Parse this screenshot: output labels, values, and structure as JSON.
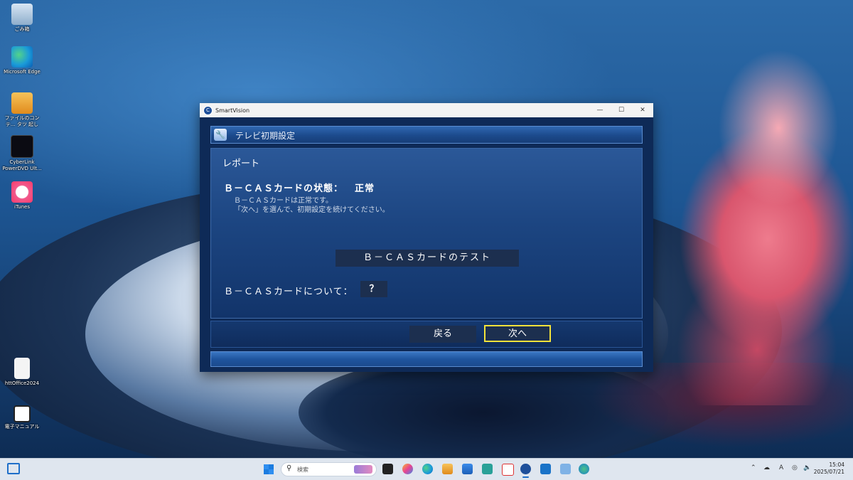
{
  "desktop": {
    "icons": [
      {
        "label": "ごみ箱",
        "icon": "recycle-bin-icon"
      },
      {
        "label": "Microsoft Edge",
        "icon": "edge-icon"
      },
      {
        "label": "ファイルのコンテ... タツ 起し",
        "icon": "folder-shortcut-icon"
      },
      {
        "label": "CyberLink PowerDVD Ult...",
        "icon": "powerdvd-icon"
      },
      {
        "label": "iTunes",
        "icon": "itunes-icon"
      },
      {
        "label": "httOffice2024",
        "icon": "file-icon"
      },
      {
        "label": "電子マニュアル",
        "icon": "manual-icon"
      }
    ]
  },
  "window": {
    "title": "SmartVision",
    "app_icon_glyph": "C",
    "controls": {
      "minimize": "—",
      "maximize": "☐",
      "close": "✕"
    }
  },
  "dialog": {
    "header_title": "テレビ初期設定",
    "report_title": "レポート",
    "status_label": "Ｂ－ＣＡＳカードの状態：",
    "status_value": "正常",
    "desc_line1": "Ｂ－ＣＡＳカードは正常です。",
    "desc_line2": "「次へ」を選んで、初期設定を続けてください。",
    "test_button": "Ｂ－ＣＡＳカードのテスト",
    "about_label": "Ｂ－ＣＡＳカードについて：",
    "help_button": "？",
    "back_button": "戻る",
    "next_button": "次へ"
  },
  "taskbar": {
    "search_placeholder": "検索",
    "tray_language": "A",
    "time": "15:04",
    "date": "2025/07/21"
  },
  "colors": {
    "accent": "#1f6fc9",
    "focus": "#f2e23a",
    "dialog_bg": "#1c4581"
  }
}
